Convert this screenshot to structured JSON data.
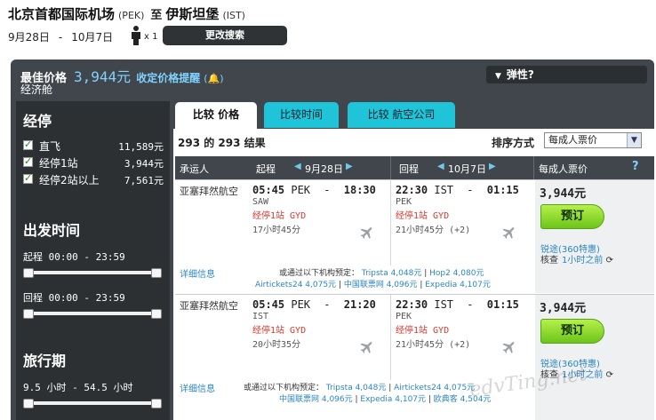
{
  "header": {
    "origin": "北京首都国际机场",
    "origin_code": "(PEK)",
    "to": "至",
    "destination": "伊斯坦堡",
    "destination_code": "(IST)",
    "depart_date": "9月28日",
    "date_dash": "-",
    "return_date": "10月7日",
    "passenger_count": "x 1",
    "change_search": "更改搜索"
  },
  "summary": {
    "best_price_label": "最佳价格",
    "best_price": "3,944元",
    "price_alert": "收定价格提醒",
    "cabin": "经济舱",
    "flex_label": "弹性?"
  },
  "sidebar": {
    "stops_title": "经停",
    "stops": [
      {
        "label": "直飞",
        "value": "11,589元"
      },
      {
        "label": "经停1站",
        "value": "3,944元"
      },
      {
        "label": "经停2站以上",
        "value": "7,561元"
      }
    ],
    "time_title": "出发时间",
    "outbound_range": "起程  00:00  -  23:59",
    "return_range": "回程  00:00  -  23:59",
    "duration_title": "旅行期",
    "duration_range": "9.5 小时  -  54.5 小时"
  },
  "tabs": [
    "比较 价格",
    "比较时间",
    "比较 航空公司"
  ],
  "results": {
    "count": "293 的 293 结果",
    "sort_label": "排序方式",
    "sort_value": "每成人票价"
  },
  "columns": {
    "airline": "承运人",
    "outbound": "起程",
    "outbound_date": "9月28日",
    "return": "回程",
    "return_date": "10月7日",
    "price": "每成人票价",
    "help": "?"
  },
  "flights": [
    {
      "airline": "亚塞拜然航空",
      "out": {
        "dep": "05:45",
        "dep_code": "PEK",
        "dash": "-",
        "arr": "18:30",
        "via": "SAW",
        "stops": "经停1站  GYD",
        "duration": "17小时45分"
      },
      "ret": {
        "dep": "22:30",
        "dep_code": "IST",
        "dash": "-",
        "arr": "01:15",
        "via": "PEK",
        "stops": "经停1站  GYD",
        "duration": "21小时45分   (+2)"
      },
      "price": "3,944元",
      "book": "预订",
      "agent": "锐途(360特惠)",
      "checked_label": "核查",
      "checked_time": "1小时之前",
      "details": "详细信息",
      "offers_prefix": "或通过以下机构预定：",
      "offers": [
        "Tripsta 4,048元",
        "Hop2 4,080元",
        "Airtickets24 4,075元",
        "中国联票网 4,096元",
        "Expedia 4,107元"
      ]
    },
    {
      "airline": "亚塞拜然航空",
      "out": {
        "dep": "05:45",
        "dep_code": "PEK",
        "dash": "-",
        "arr": "21:20",
        "via": "IST",
        "stops": "经停1站  GYD",
        "duration": "20小时35分"
      },
      "ret": {
        "dep": "22:30",
        "dep_code": "IST",
        "dash": "-",
        "arr": "01:15",
        "via": "PEK",
        "stops": "经停1站  GYD",
        "duration": "21小时45分   (+2)"
      },
      "price": "3,944元",
      "book": "预订",
      "agent": "锐途(360特惠)",
      "checked_label": "核查",
      "checked_time": "1小时之前",
      "details": "详细信息",
      "offers_prefix": "或通过以下机构预定：",
      "offers": [
        "Tripsta 4,048元",
        "Airtickets24 4,075元",
        "中国联票网 4,096元",
        "Expedia 4,107元",
        "欧典客 4,504元"
      ]
    }
  ],
  "watermark": "edvTing.net"
}
